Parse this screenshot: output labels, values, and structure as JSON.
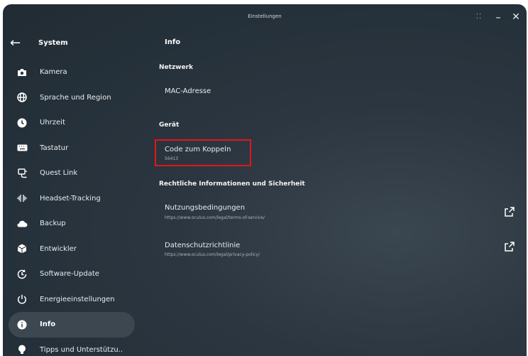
{
  "window": {
    "title": "Einstellungen"
  },
  "sidebar": {
    "back_title": "System",
    "items": [
      {
        "label": "Kamera",
        "icon": "camera-icon"
      },
      {
        "label": "Sprache und Region",
        "icon": "globe-icon"
      },
      {
        "label": "Uhrzeit",
        "icon": "clock-icon"
      },
      {
        "label": "Tastatur",
        "icon": "keyboard-icon"
      },
      {
        "label": "Quest Link",
        "icon": "link-cable-icon"
      },
      {
        "label": "Headset-Tracking",
        "icon": "tracking-icon"
      },
      {
        "label": "Backup",
        "icon": "cloud-icon"
      },
      {
        "label": "Entwickler",
        "icon": "developer-cube-icon"
      },
      {
        "label": "Software-Update",
        "icon": "update-icon"
      },
      {
        "label": "Energieeinstellungen",
        "icon": "power-icon"
      },
      {
        "label": "Info",
        "icon": "info-icon",
        "active": true
      },
      {
        "label": "Tipps und Unterstützu..",
        "icon": "lightbulb-icon"
      }
    ]
  },
  "main": {
    "title": "Info",
    "network": {
      "heading": "Netzwerk",
      "mac_label": "MAC-Adresse"
    },
    "device": {
      "heading": "Gerät",
      "pair_label": "Code zum Koppeln",
      "pair_code": "56413"
    },
    "legal": {
      "heading": "Rechtliche Informationen und Sicherheit",
      "terms_label": "Nutzungsbedingungen",
      "terms_url": "https://www.oculus.com/legal/terms-of-service/",
      "privacy_label": "Datenschutzrichtlinie",
      "privacy_url": "https://www.oculus.com/legal/privacy-policy/"
    }
  },
  "colors": {
    "highlight_border": "#e4141b",
    "active_item_bg": "#3d4750",
    "background": "#2a343d"
  }
}
